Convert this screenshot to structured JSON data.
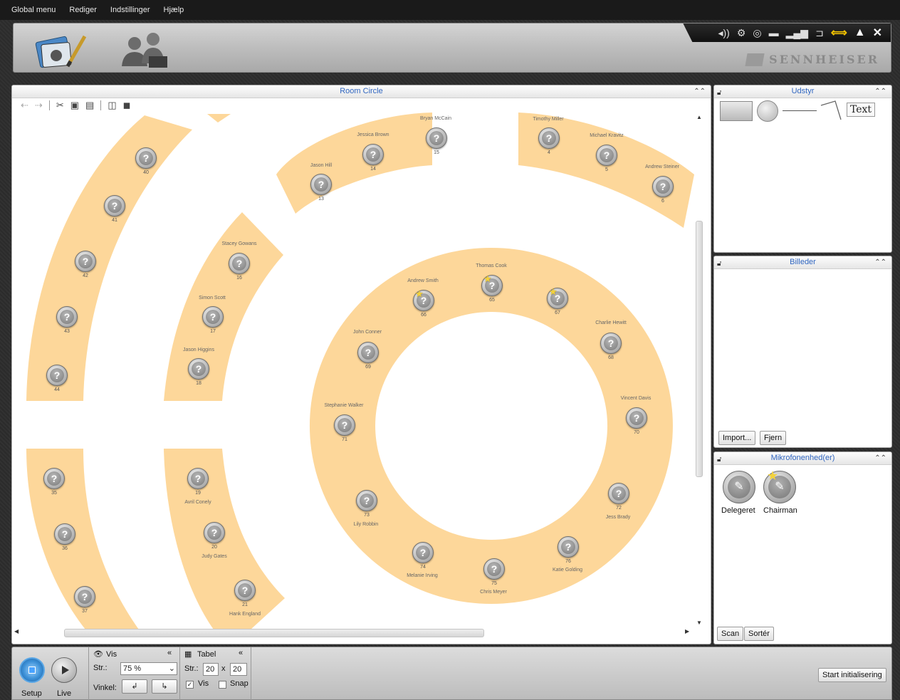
{
  "menu": [
    "Global menu",
    "Rediger",
    "Indstillinger",
    "Hjælp"
  ],
  "brand": "SENNHEISER",
  "room": {
    "title": "Room Circle",
    "seats": [
      {
        "num": "40",
        "name": ""
      },
      {
        "num": "41",
        "name": ""
      },
      {
        "num": "42",
        "name": ""
      },
      {
        "num": "43",
        "name": ""
      },
      {
        "num": "44",
        "name": ""
      },
      {
        "num": "13",
        "name": "Jason Hill"
      },
      {
        "num": "14",
        "name": "Jessica Brown"
      },
      {
        "num": "15",
        "name": "Bryan McCain"
      },
      {
        "num": "4",
        "name": "Timothy Miller"
      },
      {
        "num": "5",
        "name": "Michael Kravitz"
      },
      {
        "num": "6",
        "name": "Andrew Steiner"
      },
      {
        "num": "16",
        "name": "Stacey Gowans"
      },
      {
        "num": "17",
        "name": "Simon Scott"
      },
      {
        "num": "18",
        "name": "Jason Higgins"
      },
      {
        "num": "66",
        "name": "Andrew Smith"
      },
      {
        "num": "65",
        "name": "Thomas Cook"
      },
      {
        "num": "67",
        "name": ""
      },
      {
        "num": "68",
        "name": "Charlie Hewitt"
      },
      {
        "num": "69",
        "name": "John Conner"
      },
      {
        "num": "70",
        "name": "Vincent Davis"
      },
      {
        "num": "71",
        "name": "Stephanie Walker"
      },
      {
        "num": "72",
        "name": "Jess Brady"
      },
      {
        "num": "73",
        "name": "Lily Robbin"
      },
      {
        "num": "74",
        "name": "Melanie Irving"
      },
      {
        "num": "75",
        "name": "Chris Meyer"
      },
      {
        "num": "76",
        "name": "Katie Golding"
      },
      {
        "num": "35",
        "name": ""
      },
      {
        "num": "36",
        "name": ""
      },
      {
        "num": "37",
        "name": ""
      },
      {
        "num": "19",
        "name": "Avril Conely"
      },
      {
        "num": "20",
        "name": "Judy Gates"
      },
      {
        "num": "21",
        "name": "Hank England"
      }
    ]
  },
  "udstyr": {
    "title": "Udstyr",
    "text_tool": "Text"
  },
  "billeder": {
    "title": "Billeder",
    "import": "Import...",
    "remove": "Fjern"
  },
  "mikrofon": {
    "title": "Mikrofonenhed(er)",
    "delegate": "Delegeret",
    "chairman": "Chairman",
    "scan": "Scan",
    "sort": "Sortér"
  },
  "bottom": {
    "setup": "Setup",
    "live": "Live",
    "vis_title": "Vis",
    "size_label": "Str.:",
    "size_value": "75 %",
    "angle_label": "Vinkel:",
    "table_title": "Tabel",
    "table_size_label": "Str.:",
    "table_w": "20",
    "table_x": "x",
    "table_h": "20",
    "show_label": "Vis",
    "snap_label": "Snap",
    "start": "Start initialisering"
  },
  "colors": {
    "seat_band": "#fdd79a",
    "accent_title": "#3066c0"
  }
}
